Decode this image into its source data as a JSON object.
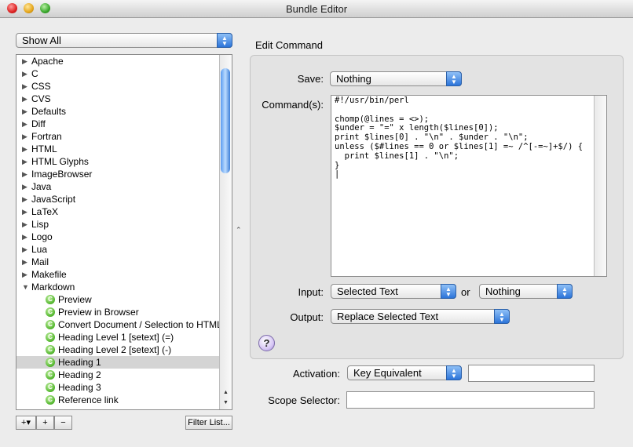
{
  "window": {
    "title": "Bundle Editor"
  },
  "filter_popup": {
    "selected": "Show All"
  },
  "bundles": [
    {
      "label": "Apache",
      "type": "bundle",
      "expanded": false
    },
    {
      "label": "C",
      "type": "bundle",
      "expanded": false
    },
    {
      "label": "CSS",
      "type": "bundle",
      "expanded": false
    },
    {
      "label": "CVS",
      "type": "bundle",
      "expanded": false
    },
    {
      "label": "Defaults",
      "type": "bundle",
      "expanded": false
    },
    {
      "label": "Diff",
      "type": "bundle",
      "expanded": false
    },
    {
      "label": "Fortran",
      "type": "bundle",
      "expanded": false
    },
    {
      "label": "HTML",
      "type": "bundle",
      "expanded": false
    },
    {
      "label": "HTML Glyphs",
      "type": "bundle",
      "expanded": false
    },
    {
      "label": "ImageBrowser",
      "type": "bundle",
      "expanded": false
    },
    {
      "label": "Java",
      "type": "bundle",
      "expanded": false
    },
    {
      "label": "JavaScript",
      "type": "bundle",
      "expanded": false
    },
    {
      "label": "LaTeX",
      "type": "bundle",
      "expanded": false
    },
    {
      "label": "Lisp",
      "type": "bundle",
      "expanded": false
    },
    {
      "label": "Logo",
      "type": "bundle",
      "expanded": false
    },
    {
      "label": "Lua",
      "type": "bundle",
      "expanded": false
    },
    {
      "label": "Mail",
      "type": "bundle",
      "expanded": false
    },
    {
      "label": "Makefile",
      "type": "bundle",
      "expanded": false
    },
    {
      "label": "Markdown",
      "type": "bundle",
      "expanded": true
    },
    {
      "label": "Preview",
      "type": "command"
    },
    {
      "label": "Preview in Browser",
      "type": "command"
    },
    {
      "label": "Convert Document / Selection to HTML",
      "type": "command"
    },
    {
      "label": "Heading Level 1 [setext] (=)",
      "type": "command"
    },
    {
      "label": "Heading Level 2 [setext] (-)",
      "type": "command"
    },
    {
      "label": "Heading 1",
      "type": "command",
      "selected": true
    },
    {
      "label": "Heading 2",
      "type": "command"
    },
    {
      "label": "Heading 3",
      "type": "command"
    },
    {
      "label": "Reference link",
      "type": "command"
    }
  ],
  "bottom_buttons": {
    "add": "+▾",
    "add_item": "+",
    "remove": "−",
    "filter": "Filter List..."
  },
  "edit": {
    "section_title": "Edit Command",
    "save_label": "Save:",
    "save_value": "Nothing",
    "command_label": "Command(s):",
    "command_text": "#!/usr/bin/perl\n\nchomp(@lines = <>);\n$under = \"=\" x length($lines[0]);\nprint $lines[0] . \"\\n\" . $under . \"\\n\";\nunless ($#lines == 0 or $lines[1] =~ /^[-=~]+$/) {\n  print $lines[1] . \"\\n\";\n}\n|",
    "input_label": "Input:",
    "input_value": "Selected Text",
    "or_label": "or",
    "input_fallback": "Nothing",
    "output_label": "Output:",
    "output_value": "Replace Selected Text",
    "help_glyph": "?"
  },
  "activation": {
    "label": "Activation:",
    "value": "Key Equivalent",
    "key_field": ""
  },
  "scope": {
    "label": "Scope Selector:",
    "value": ""
  },
  "icon_glyphs": {
    "command": "C",
    "collapsed": "▶",
    "expanded": "▼",
    "up": "▲",
    "down": "▼",
    "splitter": "⌃"
  }
}
